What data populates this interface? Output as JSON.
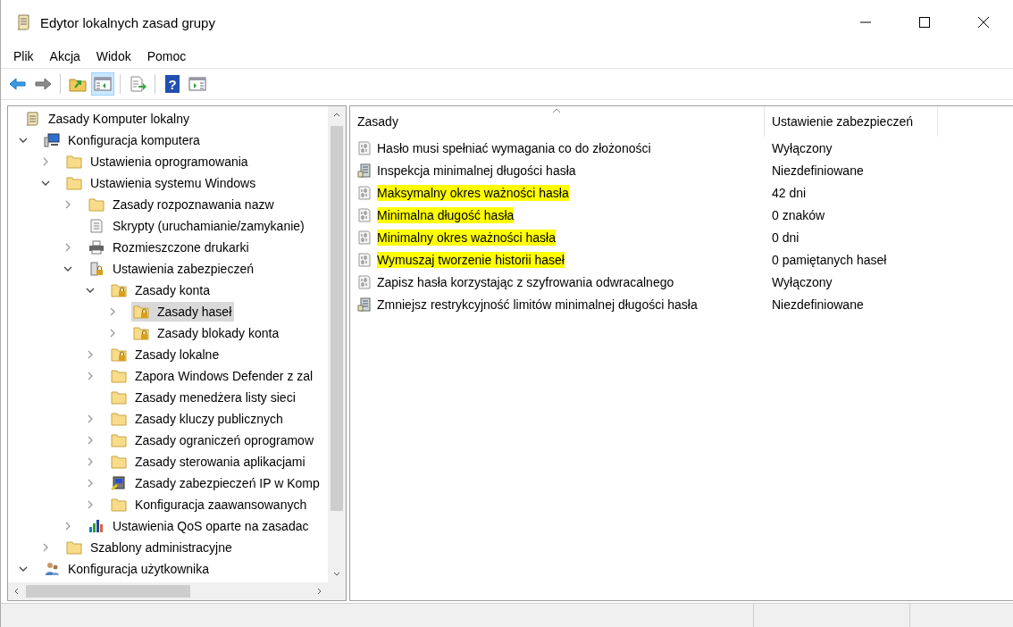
{
  "window": {
    "title": "Edytor lokalnych zasad grupy"
  },
  "menu": [
    "Plik",
    "Akcja",
    "Widok",
    "Pomoc"
  ],
  "toolbar": [
    {
      "kind": "back",
      "pressed": false
    },
    {
      "kind": "forward",
      "pressed": false
    },
    {
      "kind": "separator"
    },
    {
      "kind": "up",
      "pressed": false
    },
    {
      "kind": "tree",
      "pressed": true
    },
    {
      "kind": "separator"
    },
    {
      "kind": "export",
      "pressed": false
    },
    {
      "kind": "separator"
    },
    {
      "kind": "help",
      "pressed": false,
      "glyph": "?"
    },
    {
      "kind": "action-pane",
      "pressed": false
    }
  ],
  "tree": {
    "root": {
      "label": "Zasady Komputer lokalny",
      "kind": "scroll",
      "selected": false,
      "children": [
        {
          "label": "Konfiguracja komputera",
          "kind": "computer",
          "expanded": true,
          "selected": false,
          "children": [
            {
              "label": "Ustawienia oprogramowania",
              "kind": "folder",
              "expanded": false,
              "selected": false
            },
            {
              "label": "Ustawienia systemu Windows",
              "kind": "folder",
              "expanded": true,
              "selected": false,
              "children": [
                {
                  "label": "Zasady rozpoznawania nazw",
                  "kind": "folder",
                  "expanded": false,
                  "selected": false
                },
                {
                  "label": "Skrypty (uruchamianie/zamykanie)",
                  "kind": "script",
                  "selected": false
                },
                {
                  "label": "Rozmieszczone drukarki",
                  "kind": "printer",
                  "expanded": false,
                  "selected": false
                },
                {
                  "label": "Ustawienia zabezpieczeń",
                  "kind": "server-lock",
                  "expanded": true,
                  "selected": false,
                  "children": [
                    {
                      "label": "Zasady konta",
                      "kind": "lock-folder",
                      "expanded": true,
                      "selected": false,
                      "children": [
                        {
                          "label": "Zasady haseł",
                          "kind": "lock-folder",
                          "expanded": false,
                          "selected": true
                        },
                        {
                          "label": "Zasady blokady konta",
                          "kind": "lock-folder",
                          "expanded": false,
                          "selected": false
                        }
                      ]
                    },
                    {
                      "label": "Zasady lokalne",
                      "kind": "lock-folder",
                      "expanded": false,
                      "selected": false
                    },
                    {
                      "label": "Zapora Windows Defender z zal",
                      "kind": "folder",
                      "expanded": false,
                      "selected": false
                    },
                    {
                      "label": "Zasady menedżera listy sieci",
                      "kind": "folder",
                      "selected": false
                    },
                    {
                      "label": "Zasady kluczy publicznych",
                      "kind": "folder",
                      "expanded": false,
                      "selected": false
                    },
                    {
                      "label": "Zasady ograniczeń oprogramow",
                      "kind": "folder",
                      "expanded": false,
                      "selected": false
                    },
                    {
                      "label": "Zasady sterowania aplikacjami",
                      "kind": "folder",
                      "expanded": false,
                      "selected": false
                    },
                    {
                      "label": "Zasady zabezpieczeń IP w Komp",
                      "kind": "computer-key",
                      "expanded": false,
                      "selected": false
                    },
                    {
                      "label": "Konfiguracja zaawansowanych",
                      "kind": "folder",
                      "expanded": false,
                      "selected": false
                    }
                  ]
                },
                {
                  "label": "Ustawienia QoS oparte na zasadac",
                  "kind": "chart",
                  "expanded": false,
                  "selected": false
                }
              ]
            },
            {
              "label": "Szablony administracyjne",
              "kind": "folder",
              "expanded": false,
              "selected": false
            }
          ]
        },
        {
          "label": "Konfiguracja użytkownika",
          "kind": "users",
          "expanded": true,
          "selected": false
        }
      ]
    }
  },
  "table": {
    "columns": [
      "Zasady",
      "Ustawienie zabezpieczeń"
    ],
    "rows": [
      {
        "policy": "Hasło musi spełniać wymagania co do złożoności",
        "setting": "Wyłączony",
        "kind": "binary",
        "highlighted": false
      },
      {
        "policy": "Inspekcja minimalnej długości hasła",
        "setting": "Niezdefiniowane",
        "kind": "server",
        "highlighted": false
      },
      {
        "policy": "Maksymalny okres ważności hasła",
        "setting": "42 dni",
        "kind": "binary",
        "highlighted": true
      },
      {
        "policy": "Minimalna długość hasła",
        "setting": "0 znaków",
        "kind": "binary",
        "highlighted": true
      },
      {
        "policy": "Minimalny okres ważności hasła",
        "setting": "0 dni",
        "kind": "binary",
        "highlighted": true
      },
      {
        "policy": "Wymuszaj tworzenie historii haseł",
        "setting": "0 pamiętanych haseł",
        "kind": "binary",
        "highlighted": true
      },
      {
        "policy": "Zapisz hasła korzystając z szyfrowania odwracalnego",
        "setting": "Wyłączony",
        "kind": "binary",
        "highlighted": false
      },
      {
        "policy": "Zmniejsz restrykcyjność limitów minimalnej długości hasła",
        "setting": "Niezdefiniowane",
        "kind": "server",
        "highlighted": false
      }
    ]
  }
}
